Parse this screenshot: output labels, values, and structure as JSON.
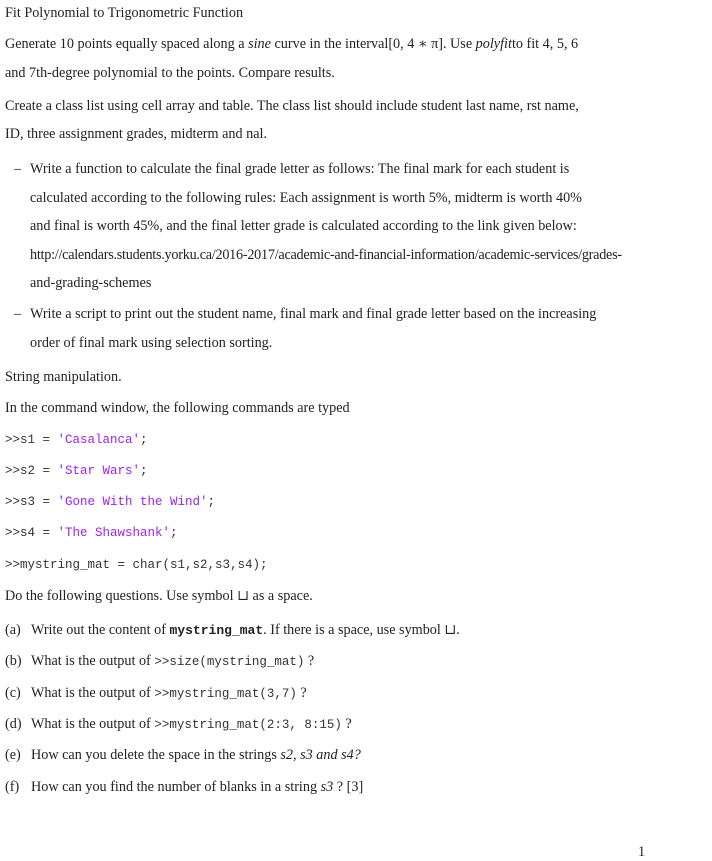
{
  "section1": {
    "title": "Fit Polynomial to Trigonometric Function",
    "p1_a": "Generate 10 points equally spaced along a ",
    "p1_sine": "sine",
    "p1_b": " curve in the interval[0, 4 ∗ π].  Use  ",
    "p1_polyfit": "polyfit",
    "p1_c": "to fit 4, 5, 6",
    "p2": "and 7th-degree polynomial to the points. Compare results."
  },
  "section2": {
    "p1": "Create a class list using cell array and table. The class list should include student last name, rst name,",
    "p2": "ID, three assignment grades, midterm and nal.",
    "bullets": [
      {
        "dash": "–",
        "lines": [
          "Write a function to calculate the final grade letter as follows: The final mark for each student is",
          "calculated according to the following rules: Each assignment is worth 5%, midterm is worth 40%",
          "and final is worth 45%, and the final letter grade is calculated according to the link given below:",
          "http://calendars.students.yorku.ca/2016-2017/academic-and-financial-information/academic-services/grades-",
          "and-grading-schemes"
        ]
      },
      {
        "dash": "–",
        "lines": [
          "Write a script to print out the student name, final mark and final grade letter based on the increasing",
          "order of final mark using selection sorting."
        ]
      }
    ]
  },
  "section3": {
    "title": "String manipulation.",
    "intro": "In the command window, the following commands are typed",
    "commands": [
      {
        "prompt": ">>s1 = ",
        "string": "'Casalanca'",
        "end": ";"
      },
      {
        "prompt": ">>s2 = ",
        "string": "'Star Wars'",
        "end": ";"
      },
      {
        "prompt": ">>s3 = ",
        "string": "'Gone With the Wind'",
        "end": ";"
      },
      {
        "prompt": ">>s4 = ",
        "string": "'The Shawshank'",
        "end": ";"
      },
      {
        "prompt": ">>mystring_mat = char(s1,s2,s3,s4);",
        "string": "",
        "end": ""
      }
    ],
    "questions_intro": "Do the following questions.  Use symbol ⊔ as a space.",
    "questions": [
      {
        "label": "(a)",
        "pre": "Write out the content of ",
        "code": "mystring_mat",
        "post": ". If there is a space, use symbol ⊔."
      },
      {
        "label": "(b)",
        "pre": "What is the output of ",
        "code": ">>size(mystring_mat)",
        "post": " ?"
      },
      {
        "label": "(c)",
        "pre": "What is the output of ",
        "code": ">>mystring_mat(3,7)",
        "post": " ?"
      },
      {
        "label": "(d)",
        "pre": "What is the output of ",
        "code": ">>mystring_mat(2:3, 8:15)",
        "post": " ?"
      },
      {
        "label": "(e)",
        "pre": "How can you delete the space in the strings ",
        "code": "s2, s3 and s4?",
        "post": ""
      },
      {
        "label": "(f)",
        "pre": "How can you find the number of blanks in a string ",
        "code": "s3",
        "post": " ?  [3]"
      }
    ]
  },
  "page_number": "1"
}
